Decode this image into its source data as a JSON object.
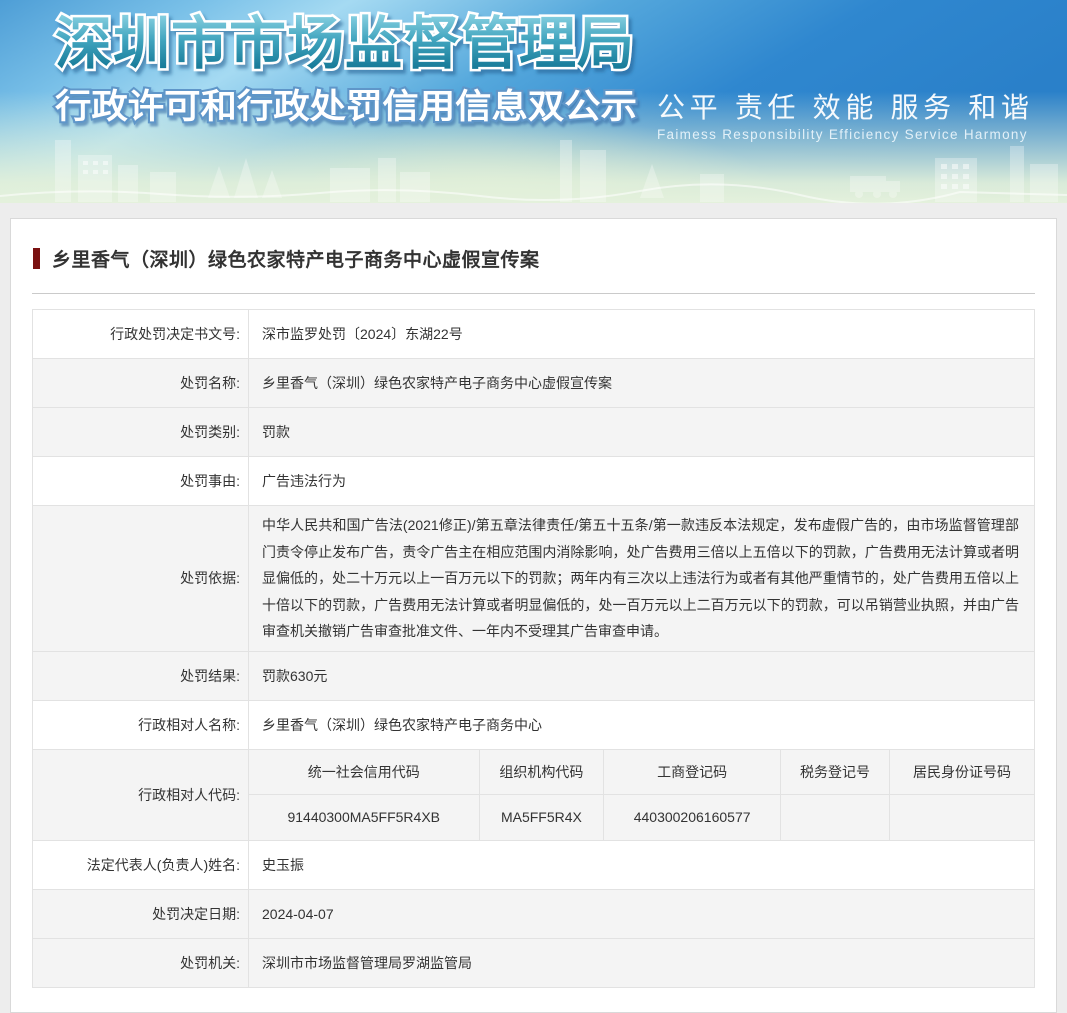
{
  "banner": {
    "title": "深圳市市场监督管理局",
    "subtitle": "行政许可和行政处罚信用信息双公示",
    "slogan": "公平 责任 效能 服务 和谐",
    "slogan_en": "Faimess Responsibility Efficiency Service Harmony",
    "colors": {
      "sky_blue": "#2f87cf",
      "sky_light": "#a5daf2",
      "bottom_green": "#e2f0da",
      "title_teal_dark": "#0c6e8d"
    }
  },
  "page": {
    "title": "乡里香气（深圳）绿色农家特产电子商务中心虚假宣传案",
    "accent_color": "#7a1111"
  },
  "table": {
    "rows_top": [
      {
        "label": "行政处罚决定书文号:",
        "value": "深市监罗处罚〔2024〕东湖22号"
      },
      {
        "label": "处罚名称:",
        "value": "乡里香气（深圳）绿色农家特产电子商务中心虚假宣传案"
      },
      {
        "label": "处罚类别:",
        "value": "罚款"
      },
      {
        "label": "处罚事由:",
        "value": "广告违法行为"
      },
      {
        "label": "处罚依据:",
        "value": "中华人民共和国广告法(2021修正)/第五章法律责任/第五十五条/第一款违反本法规定，发布虚假广告的，由市场监督管理部门责令停止发布广告，责令广告主在相应范围内消除影响，处广告费用三倍以上五倍以下的罚款，广告费用无法计算或者明显偏低的，处二十万元以上一百万元以下的罚款；两年内有三次以上违法行为或者有其他严重情节的，处广告费用五倍以上十倍以下的罚款，广告费用无法计算或者明显偏低的，处一百万元以上二百万元以下的罚款，可以吊销营业执照，并由广告审查机关撤销广告审查批准文件、一年内不受理其广告审查申请。"
      },
      {
        "label": "处罚结果:",
        "value": "罚款630元"
      },
      {
        "label": "行政相对人名称:",
        "value": "乡里香气（深圳）绿色农家特产电子商务中心"
      }
    ],
    "code_row": {
      "label": "行政相对人代码:",
      "columns": [
        "统一社会信用代码",
        "组织机构代码",
        "工商登记码",
        "税务登记号",
        "居民身份证号码"
      ],
      "values": [
        "91440300MA5FF5R4XB",
        "MA5FF5R4X",
        "440300206160577",
        "",
        ""
      ]
    },
    "rows_bottom": [
      {
        "label": "法定代表人(负责人)姓名:",
        "value": "史玉振"
      },
      {
        "label": "处罚决定日期:",
        "value": "2024-04-07"
      },
      {
        "label": "处罚机关:",
        "value": "深圳市市场监督管理局罗湖监管局"
      }
    ]
  }
}
